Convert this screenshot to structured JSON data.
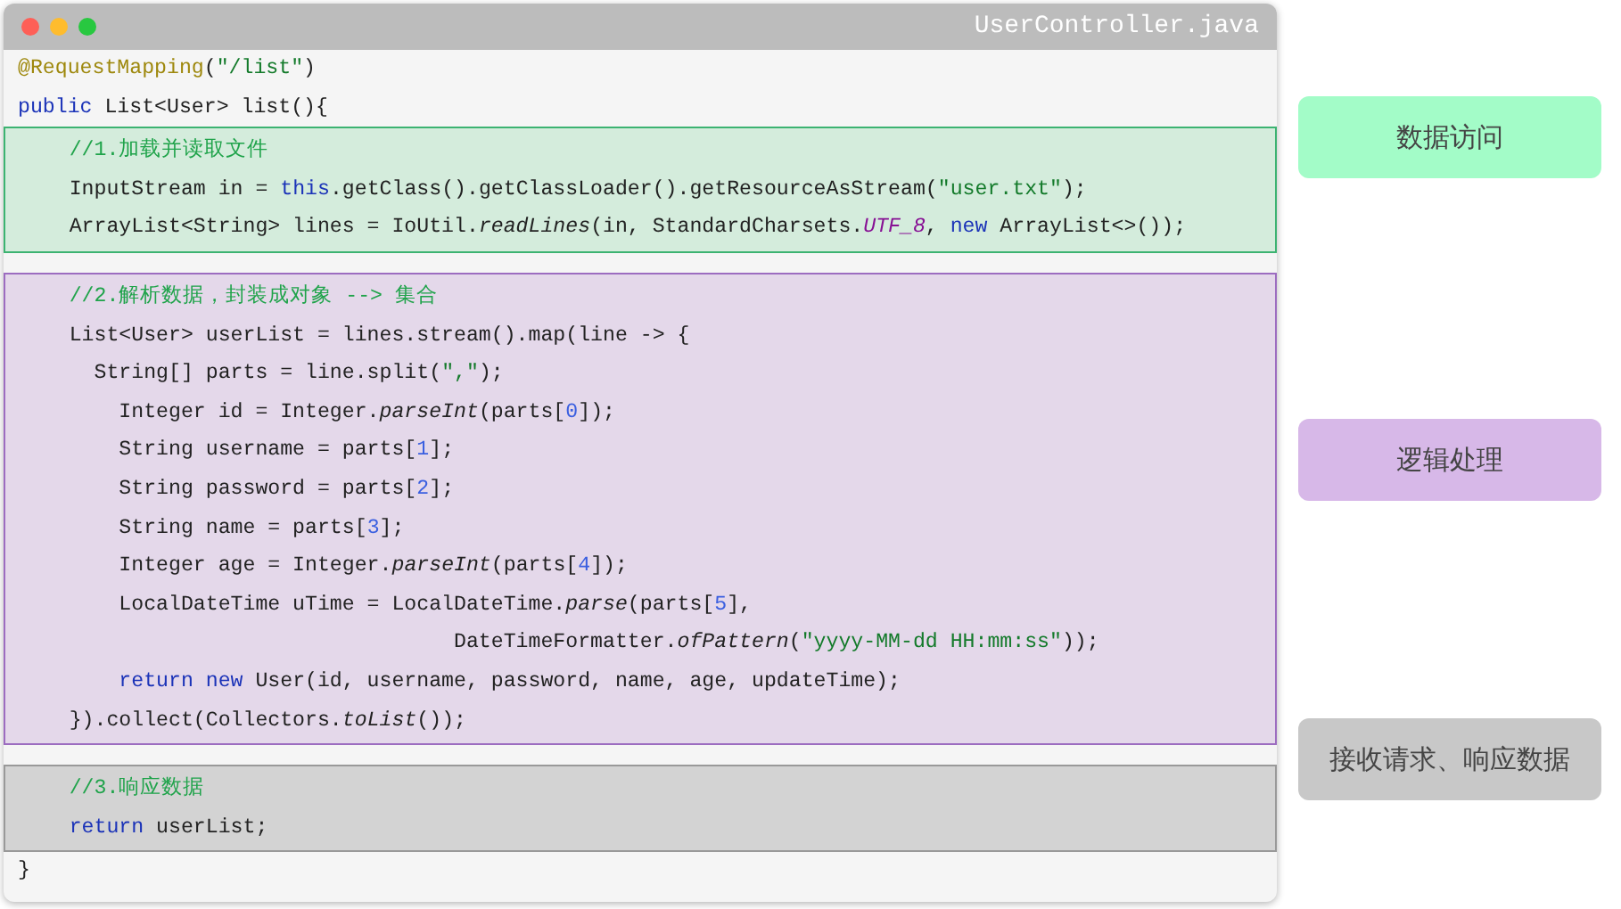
{
  "window": {
    "title": "UserController.java"
  },
  "code": {
    "sections": [
      {
        "kind": "plain",
        "lines": [
          [
            {
              "kind": "annotation",
              "text": "@RequestMapping"
            },
            {
              "kind": "plain",
              "text": "("
            },
            {
              "kind": "string",
              "text": "\"/list\""
            },
            {
              "kind": "plain",
              "text": ")"
            }
          ],
          [
            {
              "kind": "keyword",
              "text": "public"
            },
            {
              "kind": "plain",
              "text": " List<User> list(){"
            }
          ]
        ]
      },
      {
        "kind": "block",
        "color": "#d4ecdc",
        "lines": [
          [
            {
              "kind": "comment",
              "text": "    //1.加载并读取文件"
            }
          ],
          [
            {
              "kind": "plain",
              "text": "    InputStream in = "
            },
            {
              "kind": "keyword",
              "text": "this"
            },
            {
              "kind": "plain",
              "text": ".getClass().getClassLoader().getResourceAsStream("
            },
            {
              "kind": "string",
              "text": "\"user.txt\""
            },
            {
              "kind": "plain",
              "text": ");"
            }
          ],
          [
            {
              "kind": "plain",
              "text": "    ArrayList<String> lines = IoUtil."
            },
            {
              "kind": "italic",
              "text": "readLines"
            },
            {
              "kind": "plain",
              "text": "(in, StandardCharsets."
            },
            {
              "kind": "constant",
              "text": "UTF_8"
            },
            {
              "kind": "plain",
              "text": ", "
            },
            {
              "kind": "keyword",
              "text": "new"
            },
            {
              "kind": "plain",
              "text": " ArrayList<>());"
            }
          ]
        ]
      },
      {
        "kind": "block",
        "color": "#e4d8ea",
        "lines": [
          [
            {
              "kind": "comment",
              "text": "    //2.解析数据，封装成对象 --> 集合"
            }
          ],
          [
            {
              "kind": "plain",
              "text": "    List<User> userList = lines.stream().map(line -> {"
            }
          ],
          [
            {
              "kind": "plain",
              "text": "      String[] parts = line.split("
            },
            {
              "kind": "string",
              "text": "\",\""
            },
            {
              "kind": "plain",
              "text": ");"
            }
          ],
          [
            {
              "kind": "plain",
              "text": "        Integer id = Integer."
            },
            {
              "kind": "italic",
              "text": "parseInt"
            },
            {
              "kind": "plain",
              "text": "(parts["
            },
            {
              "kind": "number",
              "text": "0"
            },
            {
              "kind": "plain",
              "text": "]);"
            }
          ],
          [
            {
              "kind": "plain",
              "text": "        String username = parts["
            },
            {
              "kind": "number",
              "text": "1"
            },
            {
              "kind": "plain",
              "text": "];"
            }
          ],
          [
            {
              "kind": "plain",
              "text": "        String password = parts["
            },
            {
              "kind": "number",
              "text": "2"
            },
            {
              "kind": "plain",
              "text": "];"
            }
          ],
          [
            {
              "kind": "plain",
              "text": "        String name = parts["
            },
            {
              "kind": "number",
              "text": "3"
            },
            {
              "kind": "plain",
              "text": "];"
            }
          ],
          [
            {
              "kind": "plain",
              "text": "        Integer age = Integer."
            },
            {
              "kind": "italic",
              "text": "parseInt"
            },
            {
              "kind": "plain",
              "text": "(parts["
            },
            {
              "kind": "number",
              "text": "4"
            },
            {
              "kind": "plain",
              "text": "]);"
            }
          ],
          [
            {
              "kind": "plain",
              "text": "        LocalDateTime uTime = LocalDateTime."
            },
            {
              "kind": "italic",
              "text": "parse"
            },
            {
              "kind": "plain",
              "text": "(parts["
            },
            {
              "kind": "number",
              "text": "5"
            },
            {
              "kind": "plain",
              "text": "],"
            }
          ],
          [
            {
              "kind": "plain",
              "text": "                                   DateTimeFormatter."
            },
            {
              "kind": "italic",
              "text": "ofPattern"
            },
            {
              "kind": "plain",
              "text": "("
            },
            {
              "kind": "string",
              "text": "\"yyyy-MM-dd HH:mm:ss\""
            },
            {
              "kind": "plain",
              "text": "));"
            }
          ],
          [
            {
              "kind": "keyword",
              "text": "        return new"
            },
            {
              "kind": "plain",
              "text": " User(id, username, password, name, age, updateTime);"
            }
          ],
          [
            {
              "kind": "plain",
              "text": "    }).collect(Collectors."
            },
            {
              "kind": "italic",
              "text": "toList"
            },
            {
              "kind": "plain",
              "text": "());"
            }
          ]
        ]
      },
      {
        "kind": "block",
        "color": "#d3d3d3",
        "lines": [
          [
            {
              "kind": "comment",
              "text": "    //3.响应数据"
            }
          ],
          [
            {
              "kind": "keyword",
              "text": "    return"
            },
            {
              "kind": "plain",
              "text": " userList;"
            }
          ]
        ]
      },
      {
        "kind": "plain",
        "lines": [
          [
            {
              "kind": "plain",
              "text": "}"
            }
          ]
        ]
      }
    ]
  },
  "labels": [
    {
      "text": "数据访问",
      "color": "#a3fcc8"
    },
    {
      "text": "逻辑处理",
      "color": "#d7b8e8"
    },
    {
      "text": "接收请求、响应数据",
      "color": "#c8c8c8"
    }
  ]
}
